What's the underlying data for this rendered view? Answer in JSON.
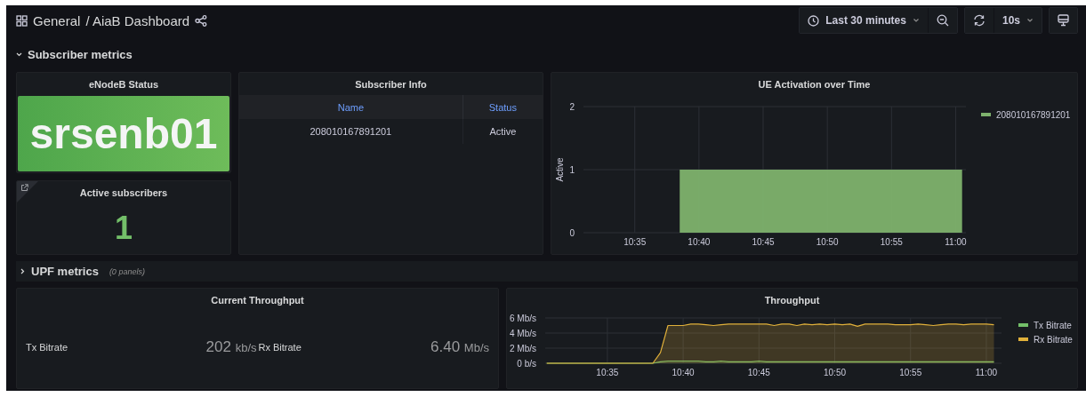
{
  "header": {
    "breadcrumb": [
      {
        "text": "General"
      },
      {
        "text": "/ AiaB Dashboard"
      }
    ],
    "time_range": "Last 30 minutes",
    "refresh_interval": "10s"
  },
  "rows": [
    {
      "title": "Subscriber metrics",
      "expanded": true,
      "panels": [
        {
          "kind": "status",
          "title": "eNodeB Status",
          "value": "srsenb01"
        },
        {
          "kind": "stat",
          "title": "Active subscribers",
          "value": "1",
          "linked": true
        },
        {
          "kind": "table",
          "title": "Subscriber Info",
          "columns": [
            "Name",
            "Status"
          ],
          "rows": [
            [
              "208010167891201",
              "Active"
            ]
          ]
        },
        {
          "kind": "chart",
          "title": "UE Activation over Time",
          "chart_data": {
            "type": "area",
            "grid": true,
            "legend": "right",
            "ylabel": "Active",
            "categories": [
              null,
              null,
              null,
              null,
              null,
              null,
              null,
              null,
              "10:35",
              null,
              null,
              null,
              null,
              null,
              null,
              null,
              null,
              null,
              "10:40",
              null,
              null,
              null,
              null,
              null,
              null,
              null,
              null,
              null,
              "10:45",
              null,
              null,
              null,
              null,
              null,
              null,
              null,
              null,
              null,
              "10:50",
              null,
              null,
              null,
              null,
              null,
              null,
              null,
              null,
              null,
              "10:55",
              null,
              null,
              null,
              null,
              null,
              null,
              null,
              null,
              null,
              "11:00",
              null
            ],
            "ylim": [
              0,
              2
            ],
            "yticks": [
              0,
              1,
              2
            ],
            "series": [
              {
                "name": "208010167891201",
                "color": "#7eb26d",
                "values": [
                  null,
                  null,
                  null,
                  null,
                  null,
                  null,
                  null,
                  null,
                  null,
                  null,
                  null,
                  null,
                  null,
                  null,
                  null,
                  1,
                  1,
                  1,
                  1,
                  1,
                  1,
                  1,
                  1,
                  1,
                  1,
                  1,
                  1,
                  1,
                  1,
                  1,
                  1,
                  1,
                  1,
                  1,
                  1,
                  1,
                  1,
                  1,
                  1,
                  1,
                  1,
                  1,
                  1,
                  1,
                  1,
                  1,
                  1,
                  1,
                  1,
                  1,
                  1,
                  1,
                  1,
                  1,
                  1,
                  1,
                  1,
                  1,
                  1,
                  1
                ]
              }
            ]
          }
        }
      ]
    },
    {
      "title": "UPF metrics",
      "expanded": false,
      "summary": "(0 panels)"
    }
  ],
  "panels": [
    {
      "kind": "stats",
      "title": "Current Throughput",
      "items": [
        {
          "label": "Tx Bitrate",
          "value": "202",
          "unit": "kb/s"
        },
        {
          "label": "Rx Bitrate",
          "value": "6.40",
          "unit": "Mb/s"
        }
      ]
    },
    {
      "kind": "chart",
      "title": "Throughput",
      "chart_data": {
        "type": "area",
        "grid": true,
        "legend": "right",
        "categories": [
          null,
          null,
          null,
          null,
          null,
          null,
          null,
          null,
          "10:35",
          null,
          null,
          null,
          null,
          null,
          null,
          null,
          null,
          null,
          "10:40",
          null,
          null,
          null,
          null,
          null,
          null,
          null,
          null,
          null,
          "10:45",
          null,
          null,
          null,
          null,
          null,
          null,
          null,
          null,
          null,
          "10:50",
          null,
          null,
          null,
          null,
          null,
          null,
          null,
          null,
          null,
          "10:55",
          null,
          null,
          null,
          null,
          null,
          null,
          null,
          null,
          null,
          "11:00",
          null
        ],
        "ylim": [
          0,
          6
        ],
        "yticks": [
          {
            "value": 0,
            "label": "0 b/s"
          },
          {
            "value": 2,
            "label": "2 Mb/s"
          },
          {
            "value": 4,
            "label": "4 Mb/s"
          },
          {
            "value": 6,
            "label": "6 Mb/s"
          }
        ],
        "series": [
          {
            "name": "Tx Bitrate",
            "color": "#73bf69",
            "values": [
              0,
              0,
              0,
              0,
              0,
              0,
              0,
              0,
              0,
              0,
              0,
              0,
              0,
              0,
              0,
              0.2,
              0.3,
              0.3,
              0.3,
              0.3,
              0.3,
              0.2,
              0.2,
              0.3,
              0.2,
              0.2,
              0.2,
              0.2,
              0.3,
              0.2,
              0.2,
              0.2,
              0.2,
              0.2,
              0.2,
              0.2,
              0.2,
              0.2,
              0.2,
              0.2,
              0.2,
              0.2,
              0.2,
              0.2,
              0.2,
              0.2,
              0.2,
              0.2,
              0.2,
              0.2,
              0.2,
              0.2,
              0.2,
              0.2,
              0.2,
              0.2,
              0.2,
              0.2,
              0.2,
              0.2
            ]
          },
          {
            "name": "Rx Bitrate",
            "color": "#e0b03a",
            "values": [
              0,
              0,
              0,
              0,
              0,
              0,
              0,
              0,
              0,
              0,
              0,
              0,
              0,
              0,
              0,
              1.4,
              5.0,
              5.0,
              5.0,
              5.2,
              5.2,
              5.1,
              5.0,
              5.1,
              5.2,
              5.2,
              5.2,
              5.2,
              5.2,
              5.2,
              5.0,
              5.2,
              5.2,
              5.0,
              5.2,
              5.1,
              5.2,
              5.1,
              5.2,
              5.1,
              5.2,
              4.9,
              5.2,
              5.2,
              5.2,
              5.2,
              5.1,
              5.1,
              5.1,
              5.2,
              5.1,
              5.0,
              5.1,
              5.2,
              5.2,
              5.1,
              5.2,
              5.2,
              5.2,
              5.1
            ]
          }
        ]
      }
    }
  ]
}
